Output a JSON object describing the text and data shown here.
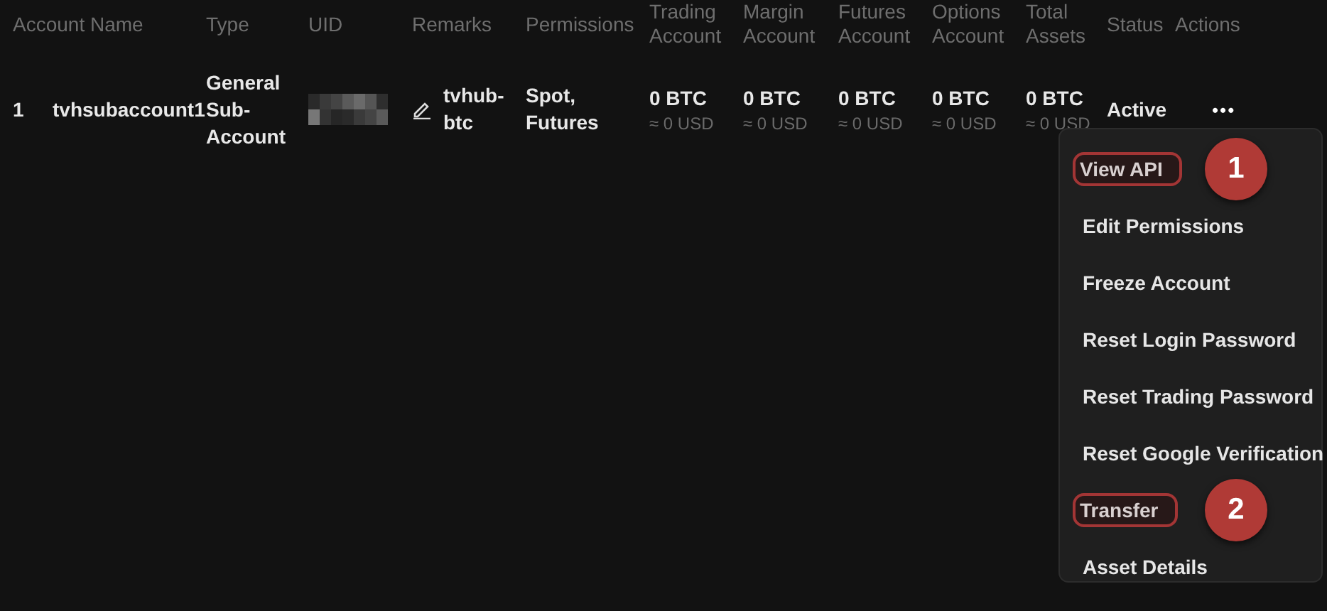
{
  "table": {
    "columns": [
      {
        "label": "Account Name"
      },
      {
        "label": "Type"
      },
      {
        "label": "UID"
      },
      {
        "label": "Remarks"
      },
      {
        "label": "Permissions"
      },
      {
        "label": "Trading Account"
      },
      {
        "label": "Margin Account"
      },
      {
        "label": "Futures Account"
      },
      {
        "label": "Options Account"
      },
      {
        "label": "Total Assets"
      },
      {
        "label": "Status"
      },
      {
        "label": "Actions"
      }
    ],
    "rows": [
      {
        "index": "1",
        "account_name": "tvhsubaccount1",
        "type": "General Sub-Account",
        "uid": {
          "kind": "redacted"
        },
        "remarks": "tvhub-btc",
        "permissions": "Spot, Futures",
        "balances": [
          {
            "amount": "0 BTC",
            "usd": "≈ 0 USD"
          },
          {
            "amount": "0 BTC",
            "usd": "≈ 0 USD"
          },
          {
            "amount": "0 BTC",
            "usd": "≈ 0 USD"
          },
          {
            "amount": "0 BTC",
            "usd": "≈ 0 USD"
          },
          {
            "amount": "0 BTC",
            "usd": "≈ 0 USD"
          }
        ],
        "status": "Active",
        "actions_button": "•••"
      }
    ]
  },
  "actions_menu": {
    "items": [
      {
        "label": "View API",
        "highlighted": true,
        "badge": "1"
      },
      {
        "label": "Edit Permissions",
        "highlighted": false
      },
      {
        "label": "Freeze Account",
        "highlighted": false
      },
      {
        "label": "Reset Login Password",
        "highlighted": false
      },
      {
        "label": "Reset Trading Password",
        "highlighted": false
      },
      {
        "label": "Reset Google Verification",
        "highlighted": false
      },
      {
        "label": "Transfer",
        "highlighted": true,
        "badge": "2"
      },
      {
        "label": "Asset Details",
        "highlighted": false
      }
    ]
  }
}
